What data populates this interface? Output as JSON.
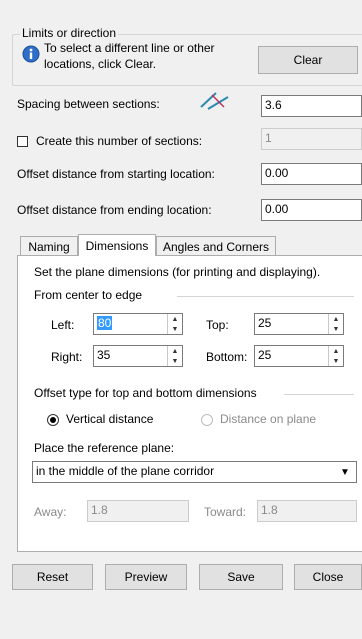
{
  "limits": {
    "title": "Limits or direction",
    "info": "To select a different line or other locations, click Clear.",
    "clear_label": "Clear"
  },
  "spacing": {
    "label": "Spacing between sections:",
    "value": "3.6"
  },
  "create_count": {
    "label": "Create this number of sections:",
    "value": "1",
    "checked": false
  },
  "offset_start": {
    "label": "Offset distance from starting location:",
    "value": "0.00"
  },
  "offset_end": {
    "label": "Offset distance from ending location:",
    "value": "0.00"
  },
  "tabs": [
    {
      "label": "Naming"
    },
    {
      "label": "Dimensions",
      "active": true
    },
    {
      "label": "Angles and Corners"
    }
  ],
  "dimensions": {
    "description": "Set the plane dimensions (for printing and displaying).",
    "center_edge_title": "From center to edge",
    "left": {
      "label": "Left:",
      "value": "80"
    },
    "top": {
      "label": "Top:",
      "value": "25"
    },
    "right": {
      "label": "Right:",
      "value": "35"
    },
    "bottom": {
      "label": "Bottom:",
      "value": "25"
    },
    "offset_type_title": "Offset type for top and bottom dimensions",
    "radio_vertical": {
      "label": "Vertical distance",
      "checked": true
    },
    "radio_plane": {
      "label": "Distance on plane",
      "checked": false
    },
    "reference_label": "Place the reference plane:",
    "reference_value": "in the middle of the plane corridor",
    "away": {
      "label": "Away:",
      "value": "1.8"
    },
    "toward": {
      "label": "Toward:",
      "value": "1.8"
    }
  },
  "buttons": {
    "reset": "Reset",
    "preview": "Preview",
    "save": "Save",
    "close": "Close"
  }
}
